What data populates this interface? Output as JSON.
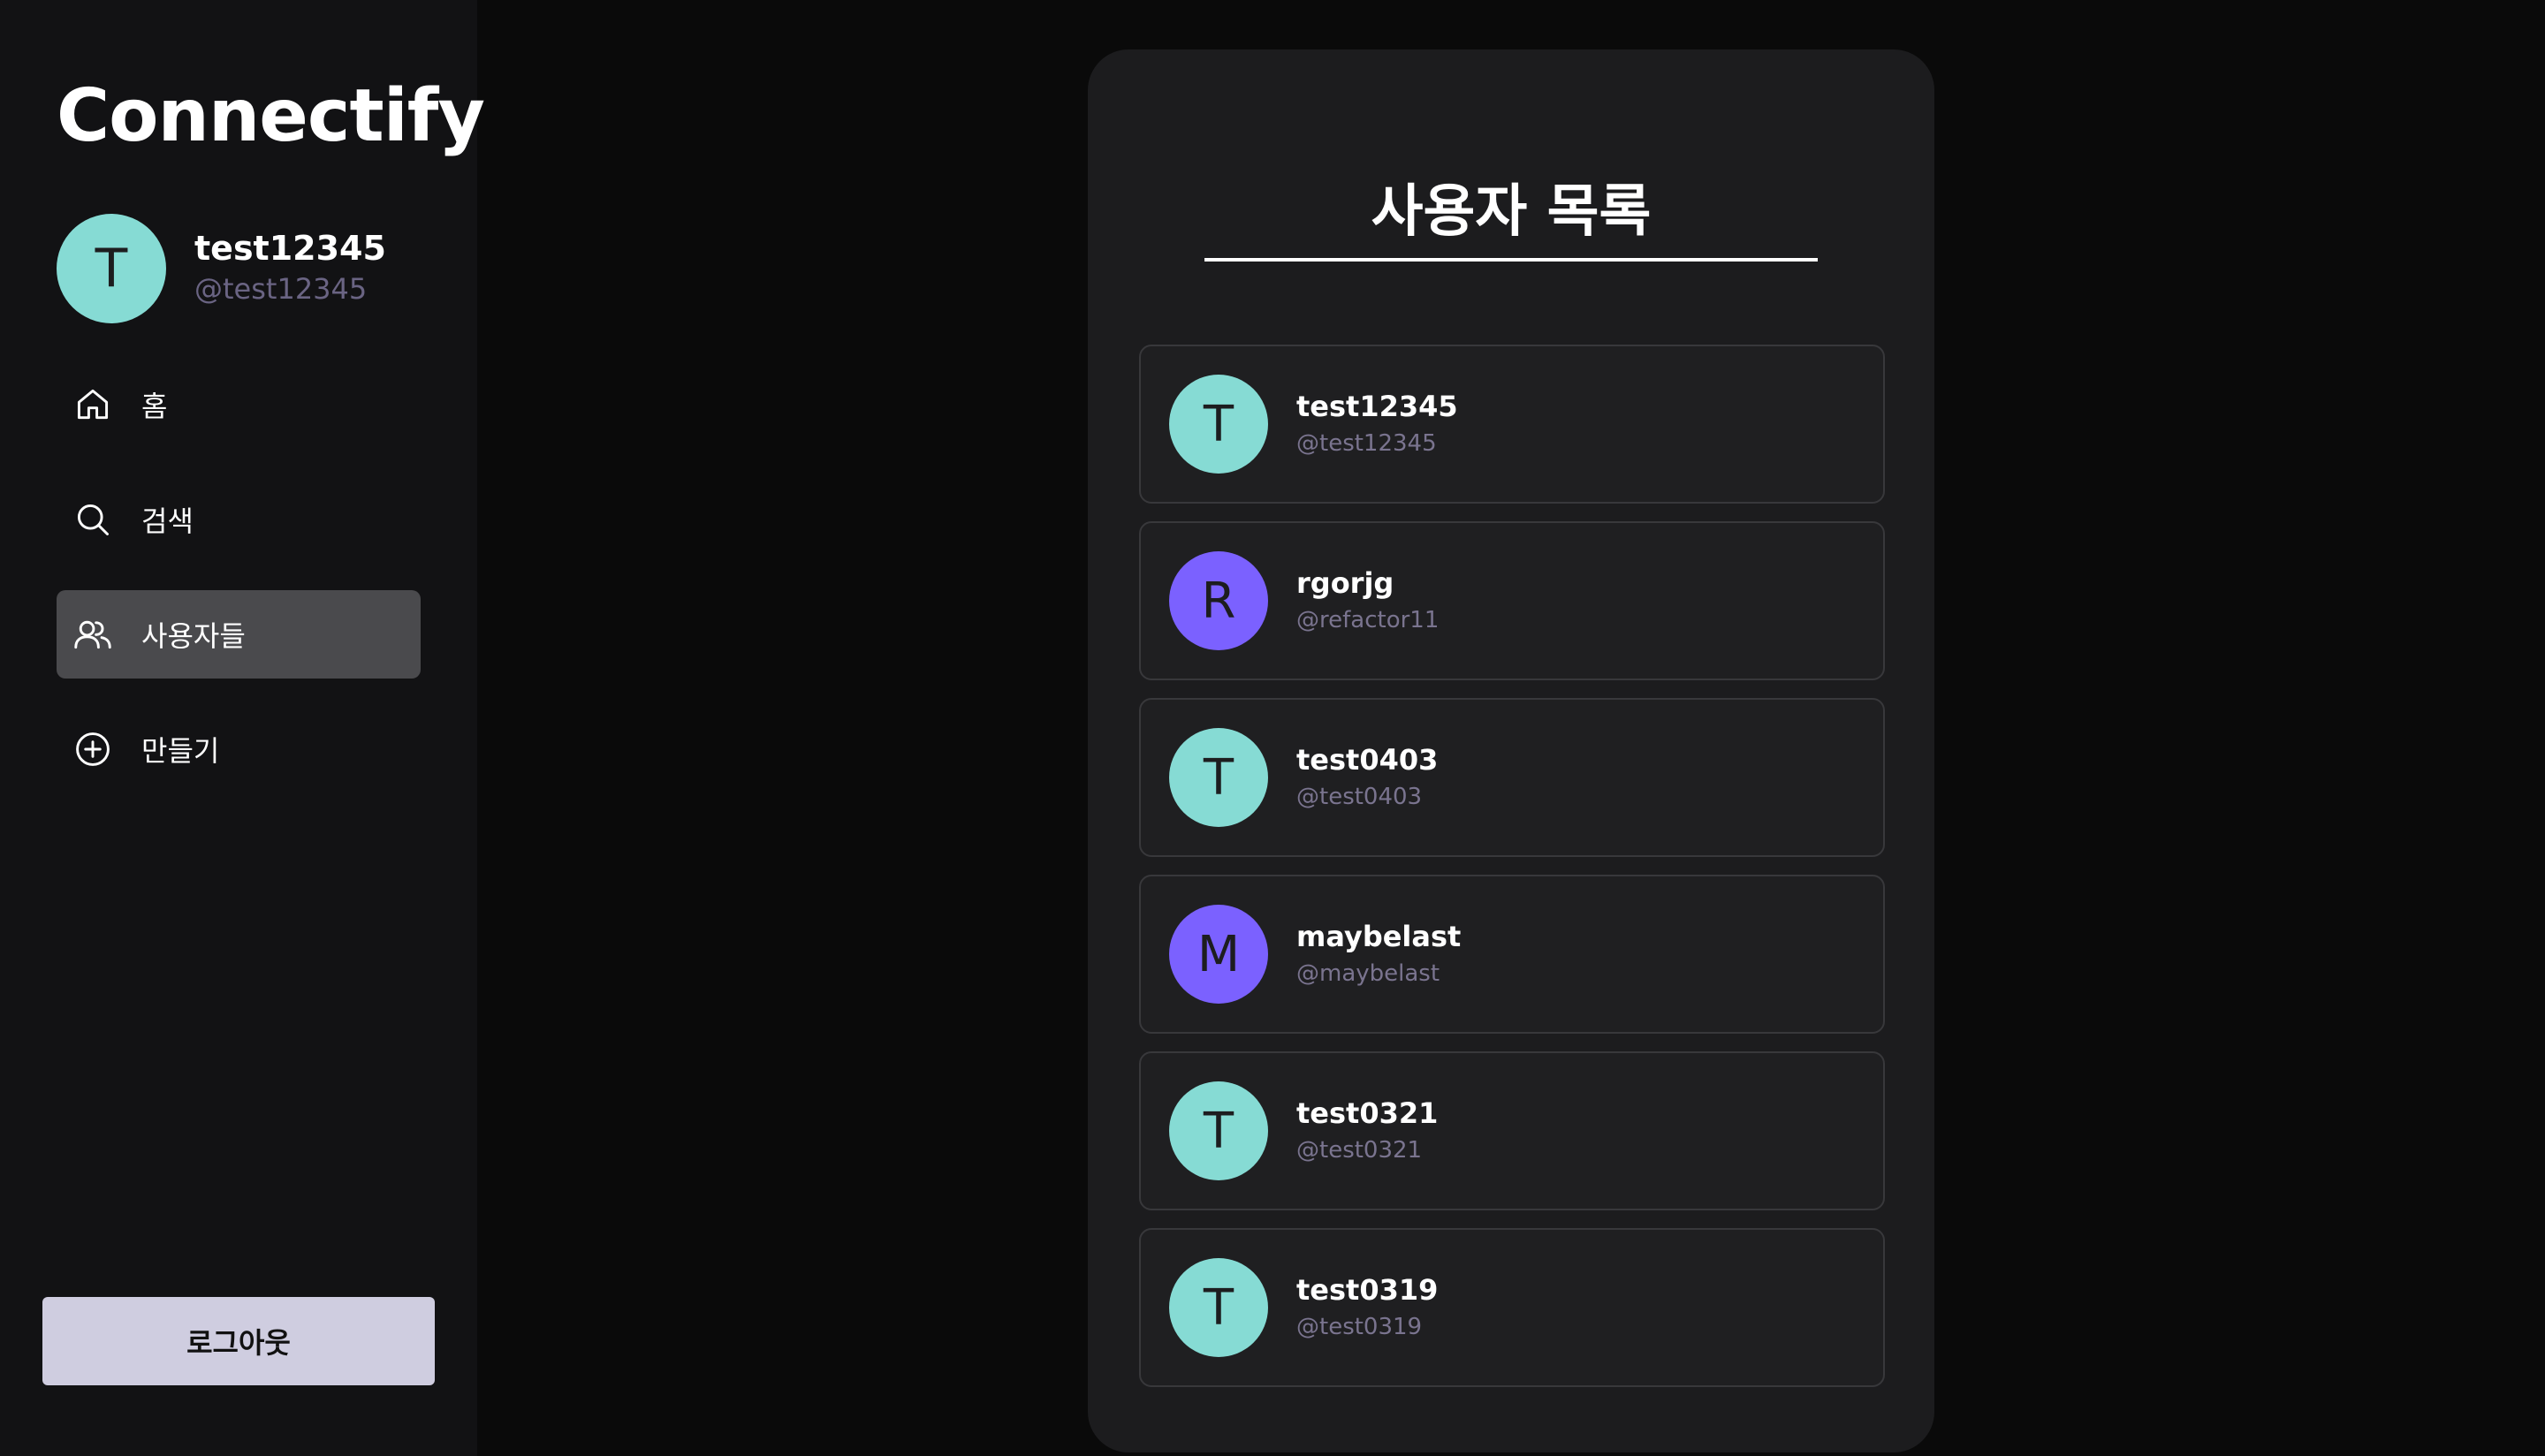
{
  "app": {
    "logo": "Connectify"
  },
  "profile": {
    "initial": "T",
    "name": "test12345",
    "handle": "@test12345",
    "avatar_color": "#86dbd4"
  },
  "nav": {
    "items": [
      {
        "label": "홈",
        "icon": "home-icon",
        "active": false
      },
      {
        "label": "검색",
        "icon": "search-icon",
        "active": false
      },
      {
        "label": "사용자들",
        "icon": "users-icon",
        "active": true
      },
      {
        "label": "만들기",
        "icon": "plus-circle-icon",
        "active": false
      }
    ]
  },
  "logout": {
    "label": "로그아웃"
  },
  "main": {
    "title": "사용자 목록",
    "users": [
      {
        "initial": "T",
        "name": "test12345",
        "handle": "@test12345",
        "color": "#86dbd4"
      },
      {
        "initial": "R",
        "name": "rgorjg",
        "handle": "@refactor11",
        "color": "#7b61ff"
      },
      {
        "initial": "T",
        "name": "test0403",
        "handle": "@test0403",
        "color": "#86dbd4"
      },
      {
        "initial": "M",
        "name": "maybelast",
        "handle": "@maybelast",
        "color": "#7b61ff"
      },
      {
        "initial": "T",
        "name": "test0321",
        "handle": "@test0321",
        "color": "#86dbd4"
      },
      {
        "initial": "T",
        "name": "test0319",
        "handle": "@test0319",
        "color": "#86dbd4"
      }
    ]
  },
  "colors": {
    "sidebar_bg": "#121214",
    "panel_bg": "#1c1c1e",
    "active_nav": "#4a4a4d",
    "logout_bg": "#cfcde0",
    "teal_avatar": "#86dbd4",
    "purple_avatar": "#7b61ff",
    "handle_text": "#7a748f"
  }
}
